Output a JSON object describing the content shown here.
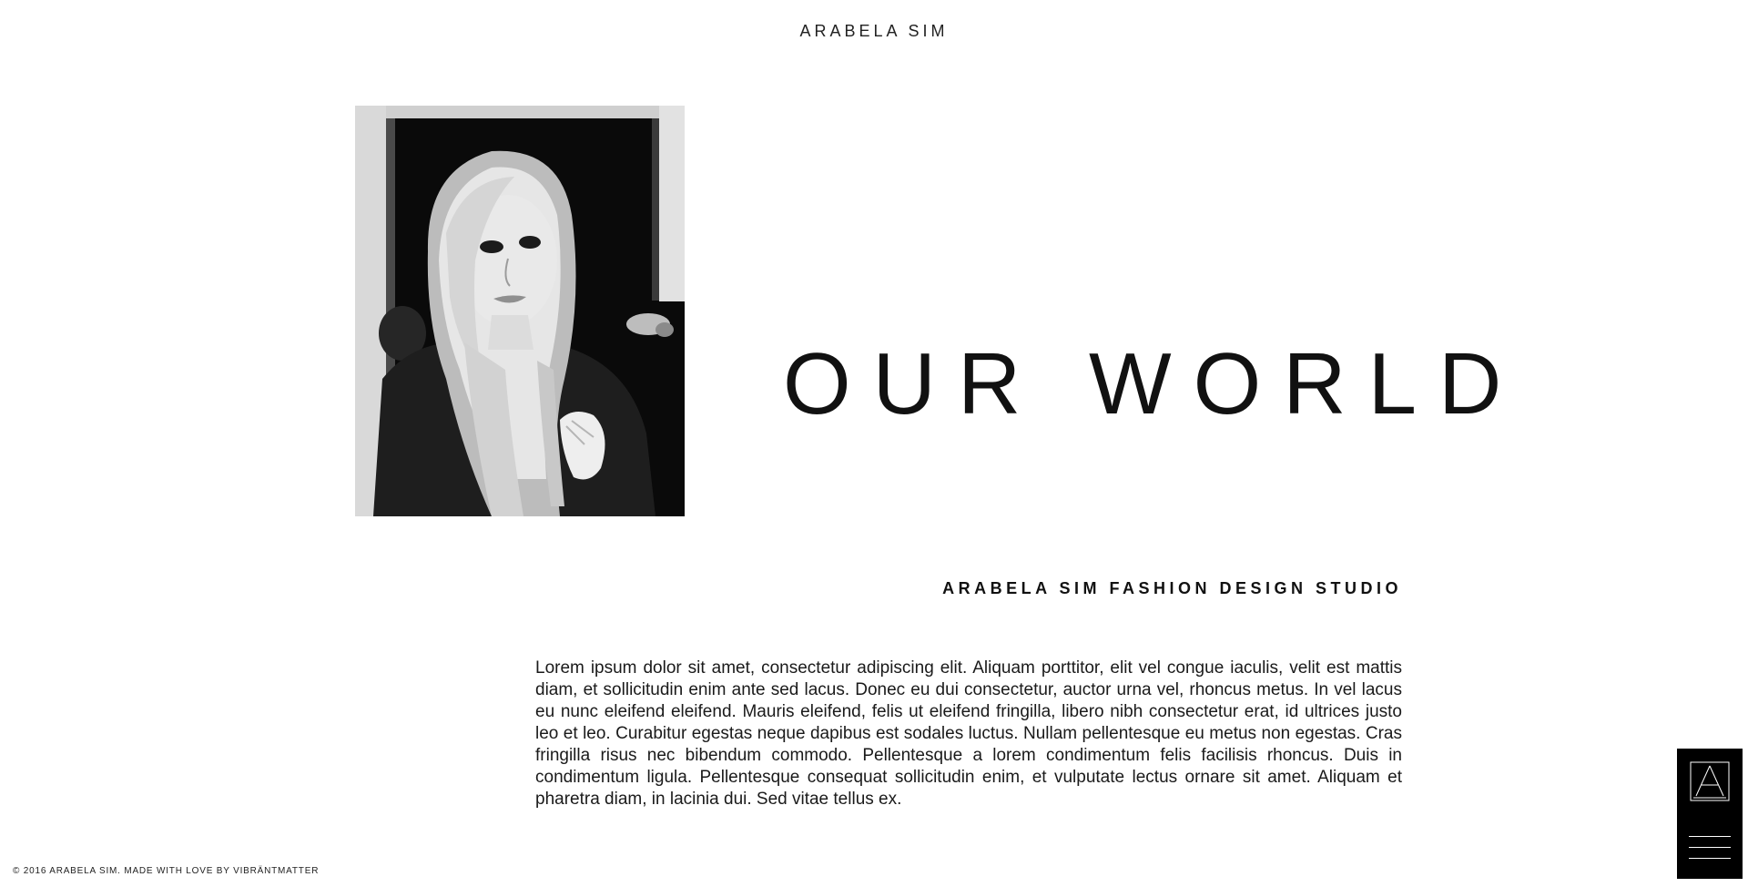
{
  "header": {
    "site_title": "ARABELA SIM"
  },
  "hero": {
    "headline": "OUR WORLD",
    "subheading": "ARABELA SIM FASHION DESIGN STUDIO",
    "body": "Lorem ipsum dolor sit amet, consectetur adipiscing elit. Aliquam porttitor, elit vel congue iaculis, velit est mattis diam, et sollicitudin enim ante sed lacus. Donec eu dui consectetur, auctor urna vel, rhoncus metus. In vel lacus eu nunc eleifend eleifend. Mauris eleifend, felis ut eleifend fringilla, libero nibh consectetur erat, id ultrices justo leo et leo. Curabitur egestas neque dapibus est sodales luctus. Nullam pellentesque eu metus non egestas. Cras fringilla risus nec bibendum commodo. Pellentesque a lorem condimentum felis facilisis rhoncus. Duis in condimentum ligula. Pellentesque consequat sollicitudin enim, et vulputate lectus ornare sit amet. Aliquam et pharetra diam, in lacinia dui. Sed vitae tellus ex."
  },
  "footer": {
    "copyright": "© 2016 ARABELA SIM. MADE WITH LOVE BY VIBRÄNTMATTER"
  },
  "side_panel": {
    "logo_icon": "triangle-a-logo-icon",
    "menu_icon": "hamburger-menu-icon"
  },
  "colors": {
    "background": "#ffffff",
    "text": "#111111",
    "panel": "#000000"
  }
}
